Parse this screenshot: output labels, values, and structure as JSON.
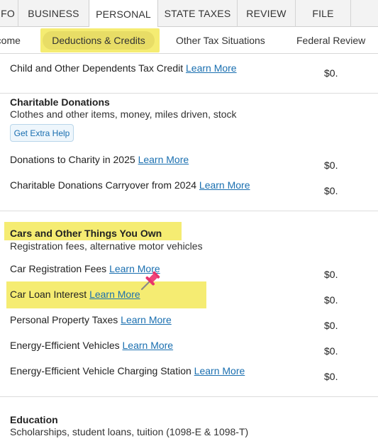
{
  "tabs": [
    {
      "label": "INFO",
      "active": false
    },
    {
      "label": "BUSINESS",
      "active": false
    },
    {
      "label": "PERSONAL",
      "active": true
    },
    {
      "label": "STATE TAXES",
      "active": false
    },
    {
      "label": "REVIEW",
      "active": false
    },
    {
      "label": "FILE",
      "active": false
    }
  ],
  "subnav": {
    "income": "Income",
    "deductions": "Deductions & Credits",
    "other": "Other Tax Situations",
    "federal_review": "Federal Review"
  },
  "rows": {
    "dependents": {
      "label": "Child and Other Dependents Tax Credit",
      "link": "Learn More",
      "amount": "$0."
    },
    "charitable": {
      "title": "Charitable Donations",
      "subtitle": "Clothes and other items, money, miles driven, stock",
      "help": "Get Extra Help"
    },
    "donations": {
      "label": "Donations to Charity in 2025",
      "link": "Learn More",
      "amount": "$0."
    },
    "carryover": {
      "label": "Charitable Donations Carryover from 2024",
      "link": "Learn More",
      "amount": "$0."
    },
    "cars": {
      "title": "Cars and Other Things You Own",
      "subtitle": "Registration fees, alternative motor vehicles"
    },
    "car_registration": {
      "label": "Car Registration Fees",
      "link": "Learn More",
      "amount": "$0."
    },
    "car_loan": {
      "label": "Car Loan Interest",
      "link": "Learn More",
      "amount": "$0."
    },
    "property_taxes": {
      "label": "Personal Property Taxes",
      "link": "Learn More",
      "amount": "$0."
    },
    "energy_vehicles": {
      "label": "Energy-Efficient Vehicles",
      "link": "Learn More",
      "amount": "$0."
    },
    "charging_station": {
      "label": "Energy-Efficient Vehicle Charging Station",
      "link": "Learn More",
      "amount": "$0."
    },
    "education": {
      "title": "Education",
      "subtitle": "Scholarships, student loans, tuition (1098-E & 1098-T)"
    }
  },
  "colors": {
    "highlight": "#f5ec72",
    "link": "#1a6fb0",
    "pin": "#e8336b"
  },
  "icons": {
    "pin": "pushpin-icon"
  }
}
